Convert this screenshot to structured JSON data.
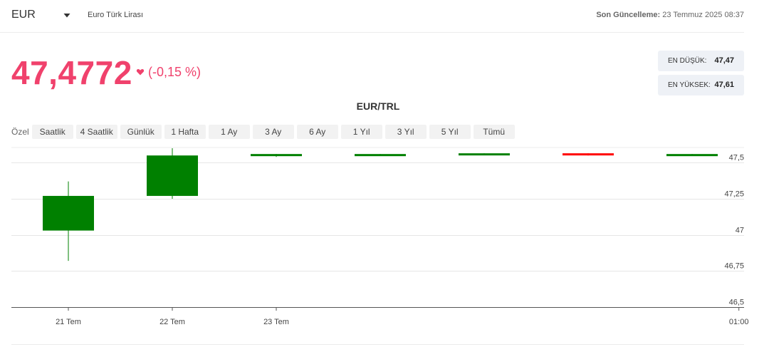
{
  "header": {
    "currency_code": "EUR",
    "currency_name": "Euro Türk Lirası",
    "updated_label": "Son Güncelleme:",
    "updated_value": "23 Temmuz 2025 08:37"
  },
  "quote": {
    "price": "47,4772",
    "change": "(-0,15 %)",
    "direction": "down",
    "color": "#f0416c"
  },
  "stats": {
    "low_label": "EN DÜŞÜK:",
    "low_value": "47,47",
    "high_label": "EN YÜKSEK:",
    "high_value": "47,61"
  },
  "range": {
    "custom_label": "Özel",
    "buttons": [
      "Saatlik",
      "4 Saatlik",
      "Günlük",
      "1 Hafta",
      "1 Ay",
      "3 Ay",
      "6 Ay",
      "1 Yıl",
      "3 Yıl",
      "5 Yıl",
      "Tümü"
    ]
  },
  "chart_data": {
    "type": "candlestick",
    "title": "EUR/TRL",
    "ylim": [
      46.5,
      47.62
    ],
    "y_ticks": [
      46.5,
      46.75,
      47,
      47.25,
      47.5
    ],
    "y_tick_labels": [
      "46,5",
      "46,75",
      "47",
      "47,25",
      "47,5"
    ],
    "x_tick_labels": [
      {
        "label": "21 Tem",
        "candle": 0
      },
      {
        "label": "22 Tem",
        "candle": 1
      },
      {
        "label": "23 Tem",
        "candle": 2
      },
      {
        "label": "01:00",
        "candle": 6.45
      }
    ],
    "up_color": "#008000",
    "down_color": "#ff0000",
    "candles": [
      {
        "open": 47.03,
        "high": 47.37,
        "low": 46.82,
        "close": 47.27
      },
      {
        "open": 47.27,
        "high": 47.6,
        "low": 47.25,
        "close": 47.55
      },
      {
        "open": 47.56,
        "high": 47.56,
        "low": 47.54,
        "close": 47.56
      },
      {
        "open": 47.55,
        "high": 47.56,
        "low": 47.55,
        "close": 47.56
      },
      {
        "open": 47.56,
        "high": 47.565,
        "low": 47.56,
        "close": 47.565
      },
      {
        "open": 47.565,
        "high": 47.565,
        "low": 47.55,
        "close": 47.555
      },
      {
        "open": 47.55,
        "high": 47.56,
        "low": 47.55,
        "close": 47.56
      }
    ]
  }
}
